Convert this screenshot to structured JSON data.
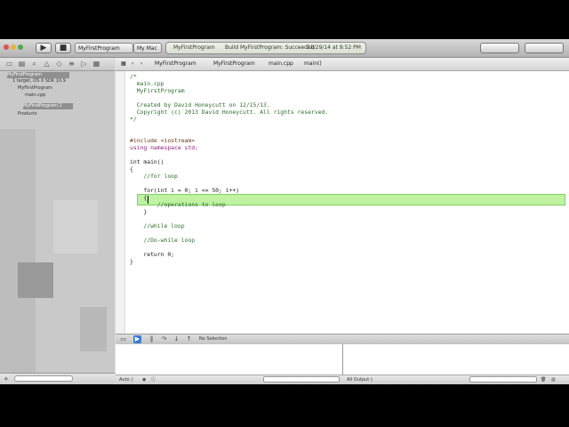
{
  "toolbar": {
    "run_glyph": "▶",
    "stop_glyph": "■",
    "scheme_project": "MyFirstProgram",
    "scheme_destination": "My Mac",
    "activity_project": "MyFirstProgram",
    "activity_status": "Build MyFirstProgram: Succeeded",
    "activity_time": "11/29/14 at 9:52 PM"
  },
  "navigator": {
    "items": [
      {
        "label": "MyFirstProgram"
      },
      {
        "label": "1 target, OS X SDK 10.9"
      },
      {
        "label": "MyFirstProgram"
      },
      {
        "label": "main.cpp"
      },
      {
        "label": "MyFirstProgram.1"
      },
      {
        "label": "Products"
      }
    ]
  },
  "jumpbar": {
    "back": "‹",
    "forward": "›",
    "crumbs": [
      "MyFirstProgram",
      "MyFirstProgram",
      "main.cpp",
      "main()"
    ]
  },
  "editor": {
    "lines": [
      {
        "text": "/*",
        "cls": "cm"
      },
      {
        "text": "  main.cpp",
        "cls": "cm"
      },
      {
        "text": "  MyFirstProgram",
        "cls": "cm"
      },
      {
        "text": "",
        "cls": ""
      },
      {
        "text": "  Created by David Honeycutt on 12/15/13.",
        "cls": "cm"
      },
      {
        "text": "  Copyright (c) 2013 David Honeycutt. All rights reserved.",
        "cls": "cm"
      },
      {
        "text": "*/",
        "cls": "cm"
      },
      {
        "text": "",
        "cls": ""
      },
      {
        "text": "",
        "cls": ""
      },
      {
        "text": "#include <iostream>",
        "cls": "pp"
      },
      {
        "text": "using namespace std;",
        "cls": "kw"
      },
      {
        "text": "",
        "cls": ""
      },
      {
        "text": "int main()",
        "cls": ""
      },
      {
        "text": "{",
        "cls": ""
      },
      {
        "text": "    //for loop",
        "cls": "cm"
      },
      {
        "text": "",
        "cls": ""
      },
      {
        "text": "    for(int i = 0; i <= 50; i++)",
        "cls": ""
      },
      {
        "text": "    {",
        "cls": ""
      },
      {
        "text": "        //operations to loop",
        "cls": "cm"
      },
      {
        "text": "    }",
        "cls": ""
      },
      {
        "text": "",
        "cls": ""
      },
      {
        "text": "    //while loop",
        "cls": "cm"
      },
      {
        "text": "",
        "cls": ""
      },
      {
        "text": "    //Do-while loop",
        "cls": "cm"
      },
      {
        "text": "",
        "cls": ""
      },
      {
        "text": "    return 0;",
        "cls": ""
      },
      {
        "text": "}",
        "cls": ""
      }
    ]
  },
  "debug": {
    "no_selection": "No Selection",
    "auto_label": "Auto ◊",
    "all_output_label": "All Output ◊"
  }
}
